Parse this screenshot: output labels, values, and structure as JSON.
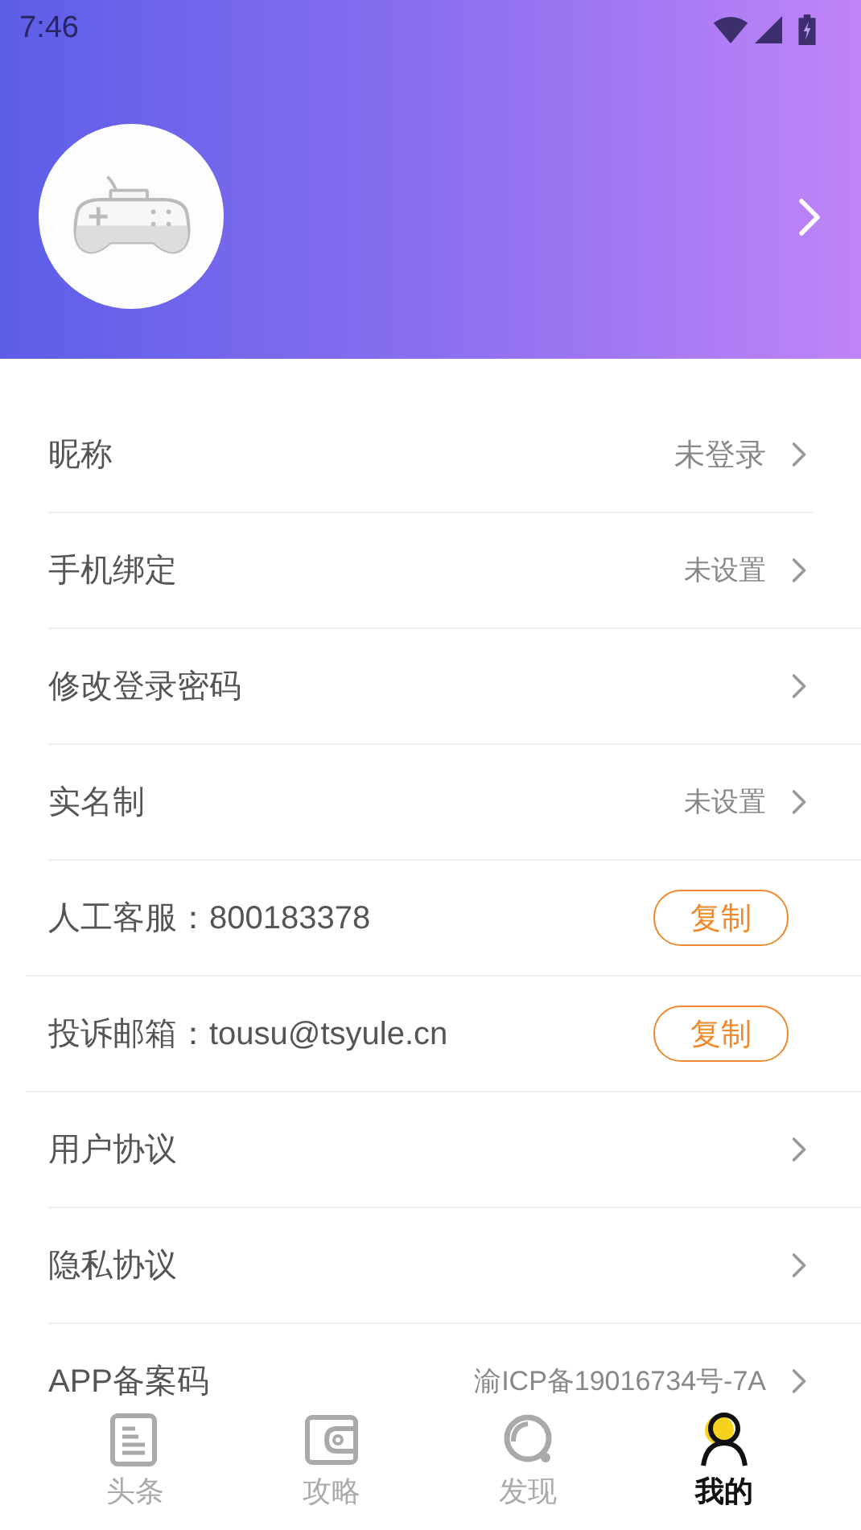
{
  "status_bar": {
    "time": "7:46"
  },
  "rows": [
    {
      "kind": "link",
      "label": "昵称",
      "value": "未登录"
    },
    {
      "kind": "link",
      "label": "手机绑定",
      "value": "未设置"
    },
    {
      "kind": "link",
      "label": "修改登录密码"
    },
    {
      "kind": "link",
      "label": "实名制",
      "value": "未设置"
    },
    {
      "kind": "copy",
      "label": "人工客服：800183378",
      "button": "复制"
    },
    {
      "kind": "copy",
      "label": "投诉邮箱：tousu@tsyule.cn",
      "button": "复制"
    },
    {
      "kind": "link",
      "label": "用户协议"
    },
    {
      "kind": "link",
      "label": "隐私协议"
    },
    {
      "kind": "link",
      "label": "APP备案码",
      "value": "渝ICP备19016734号-7A"
    }
  ],
  "tabs": [
    {
      "kind": "doc",
      "label": "头条",
      "selected": false
    },
    {
      "kind": "wallet",
      "label": "攻略",
      "selected": false
    },
    {
      "kind": "search",
      "label": "发现",
      "selected": false
    },
    {
      "kind": "person",
      "label": "我的",
      "selected": true
    }
  ]
}
